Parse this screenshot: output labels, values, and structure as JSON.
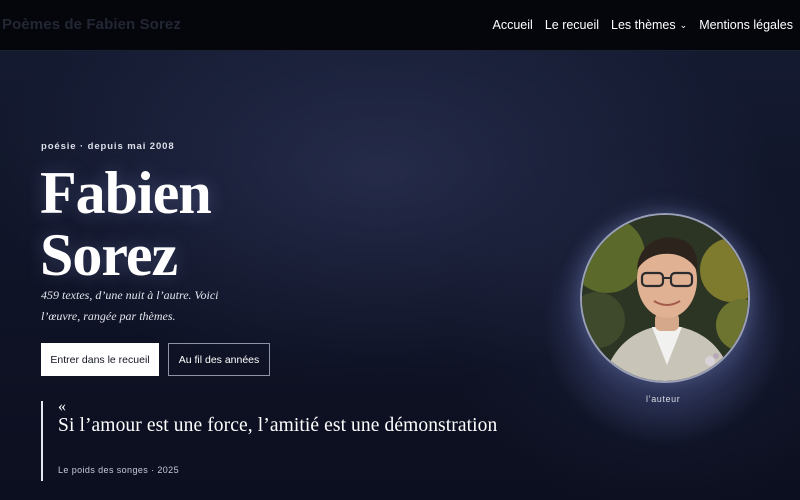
{
  "navbar": {
    "site_title": "Poèmes de Fabien Sorez",
    "links": [
      {
        "label": "Accueil"
      },
      {
        "label": "Le recueil"
      },
      {
        "label": "Les thèmes",
        "has_dropdown": true
      },
      {
        "label": "Mentions légales"
      }
    ],
    "dropdown_icon": "chevron-down-icon"
  },
  "hero": {
    "eyebrow": "poésie · depuis mai 2008",
    "name_line1": "Fabien",
    "name_line2": "Sorez",
    "tagline": "459 textes, d’une nuit à l’autre. Voici l’œuvre, rangée par thèmes.",
    "primary_button": "Entrer dans le recueil",
    "secondary_button": "Au fil des années",
    "quote_mark": "«",
    "quote_text": "Si l’amour est une force, l’amitié est une démonstration",
    "quote_source": "Le poids des songes · 2025",
    "portrait_caption": "l’auteur"
  },
  "colors": {
    "navbar_bg": "#04060c",
    "hero_bg": "#0f1326",
    "text": "#ffffff",
    "primary_button_bg": "#ffffff"
  }
}
